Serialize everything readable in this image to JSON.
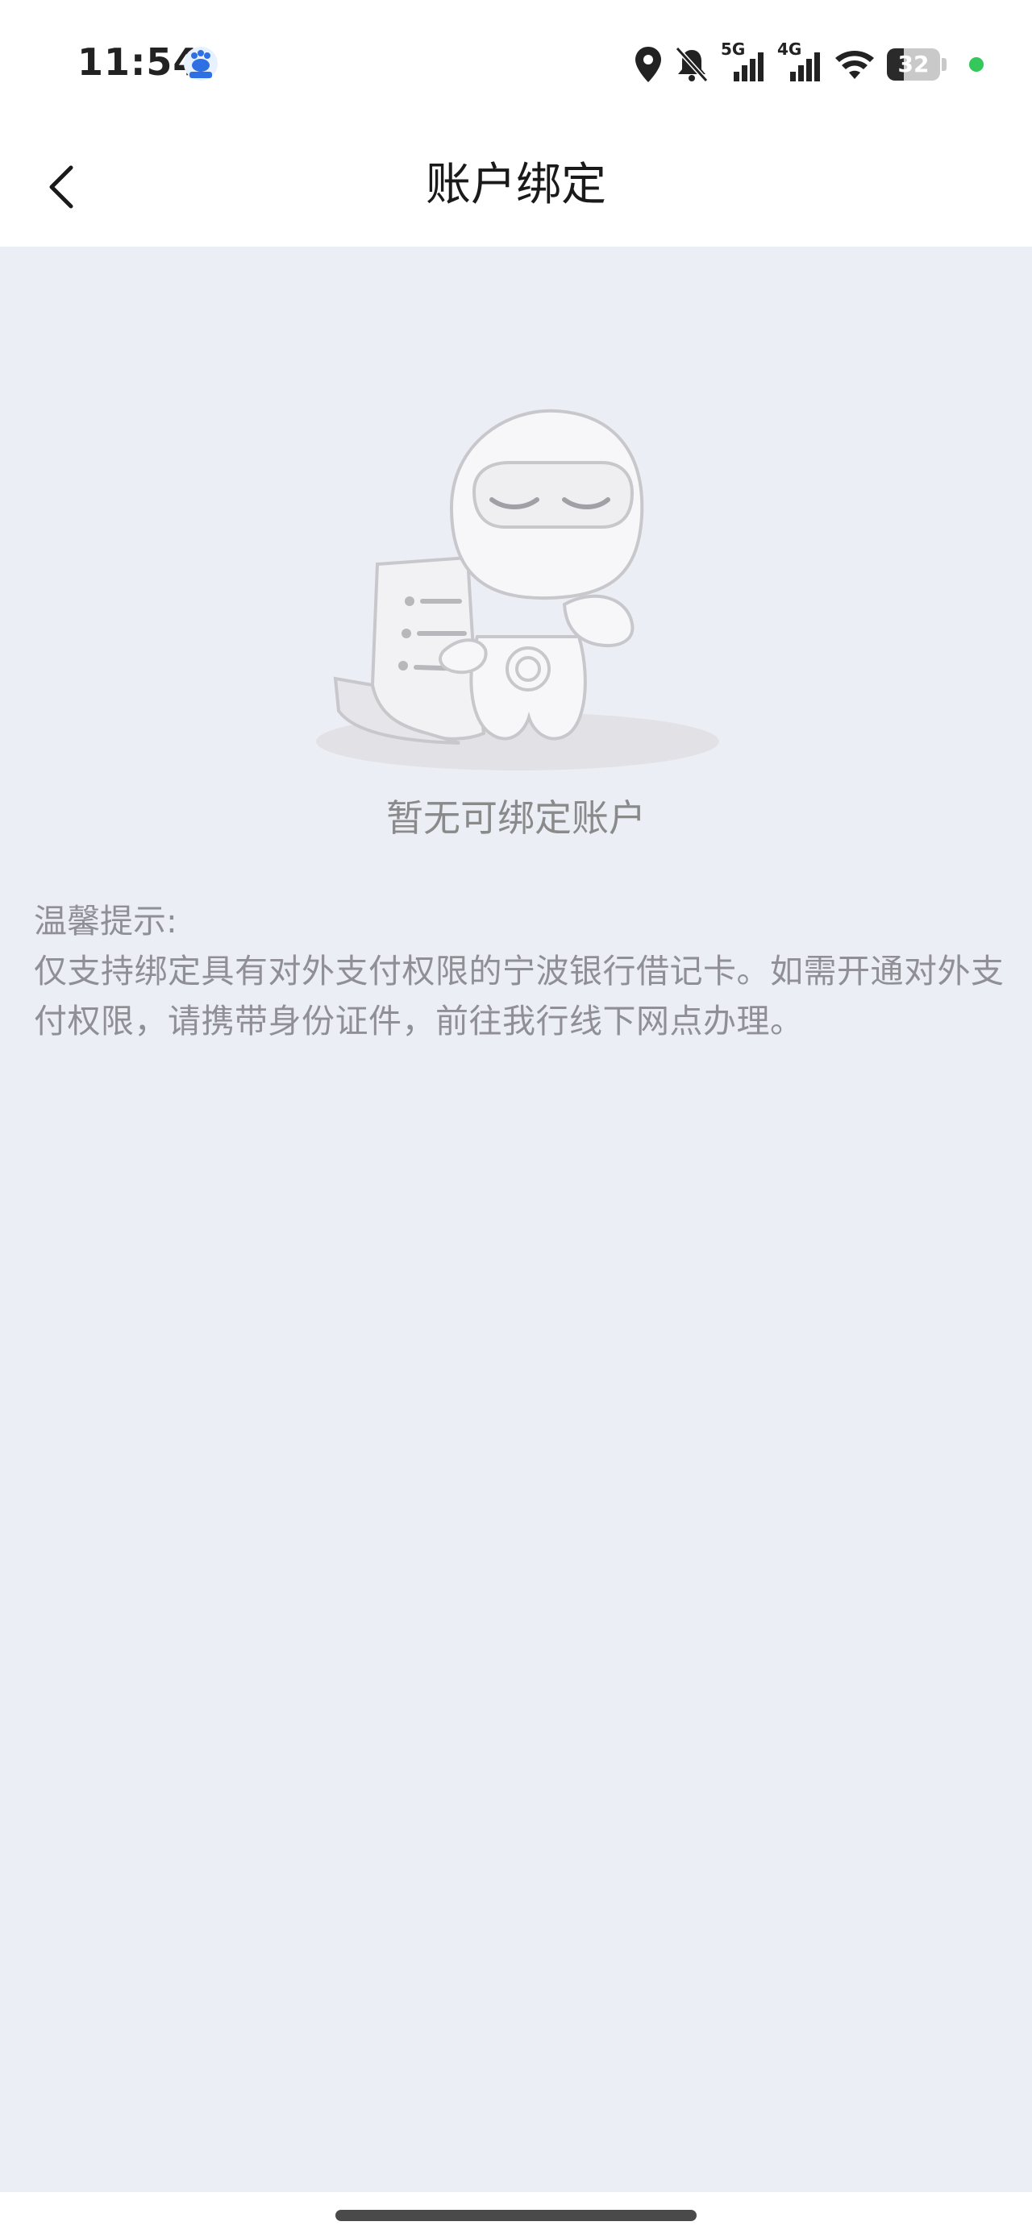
{
  "status_bar": {
    "time": "11:54",
    "network_5g": "5G",
    "network_4g": "4G",
    "battery_level": "32",
    "battery_fraction": 0.32,
    "icons": [
      "baidu-app-icon",
      "location-icon",
      "bell-muted-icon",
      "signal-5g-icon",
      "signal-4g-icon",
      "wifi-icon",
      "battery-icon",
      "green-dot-indicator"
    ]
  },
  "header": {
    "title": "账户绑定",
    "back_icon": "chevron-left-icon"
  },
  "empty_state": {
    "illustration": "sleeping-robot-illustration",
    "message": "暂无可绑定账户"
  },
  "tips": {
    "title": "温馨提示:",
    "body": "仅支持绑定具有对外支付权限的宁波银行借记卡。如需开通对外支付权限，请携带身份证件，前往我行线下网点办理。"
  },
  "colors": {
    "background": "#eceef6",
    "header_bg": "#ffffff",
    "text_primary": "#1a1a1a",
    "text_secondary": "#8f8f95",
    "status_green": "#34c759"
  }
}
